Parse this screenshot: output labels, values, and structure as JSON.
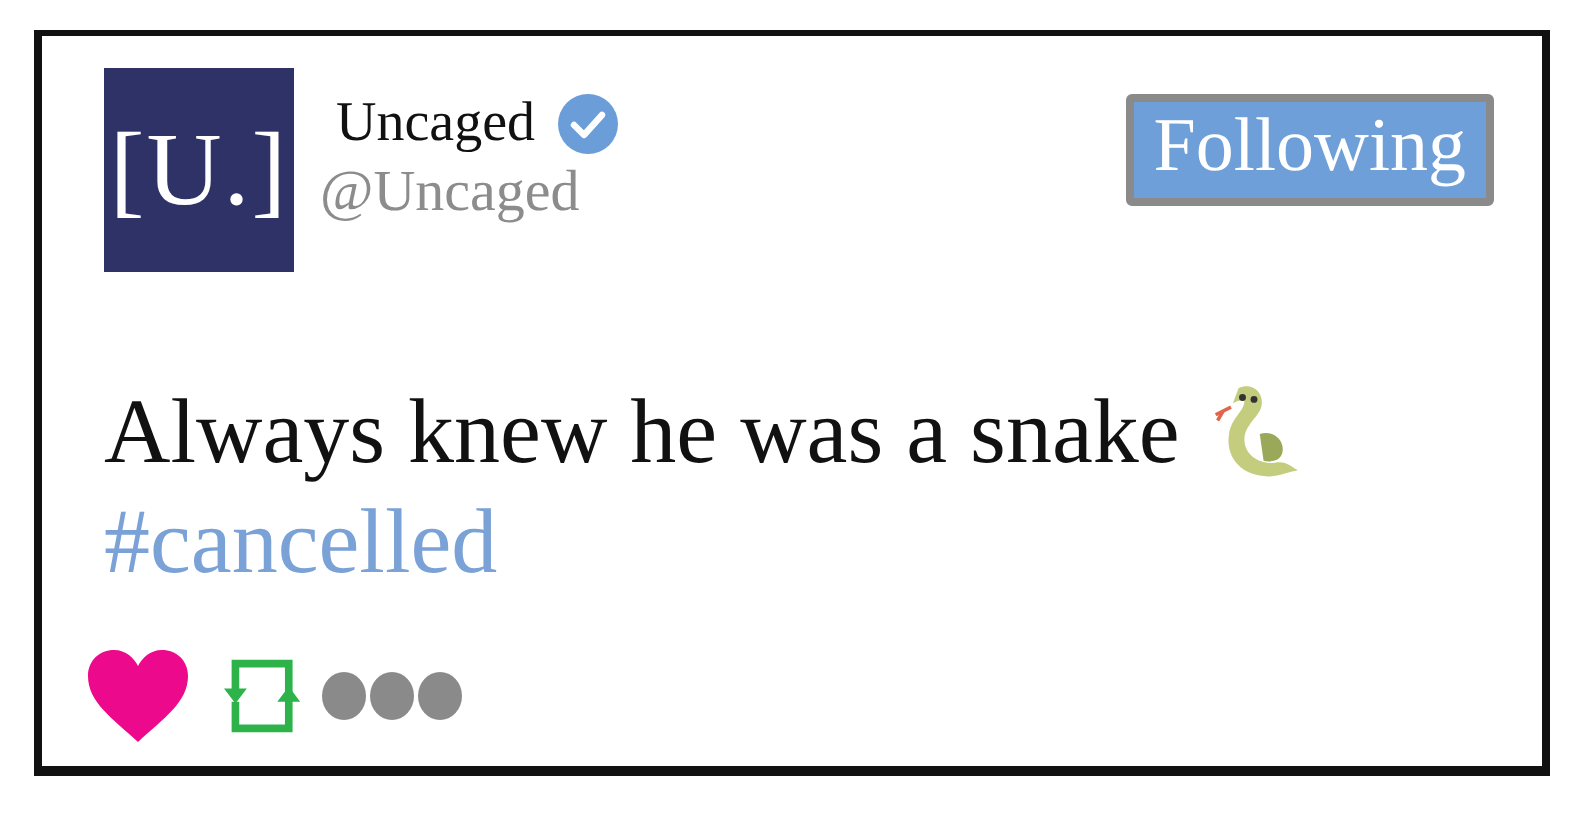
{
  "tweet": {
    "avatar": {
      "text": "[U.]"
    },
    "author": {
      "name": "Uncaged",
      "verified": true,
      "handle": "@Uncaged"
    },
    "follow_button": {
      "label": "Following",
      "selected": true
    },
    "text": "Always knew he was a snake",
    "has_snake_emoji": true,
    "hashtag": "#cancelled",
    "actions": {
      "liked": true,
      "retweeted": true
    }
  }
}
